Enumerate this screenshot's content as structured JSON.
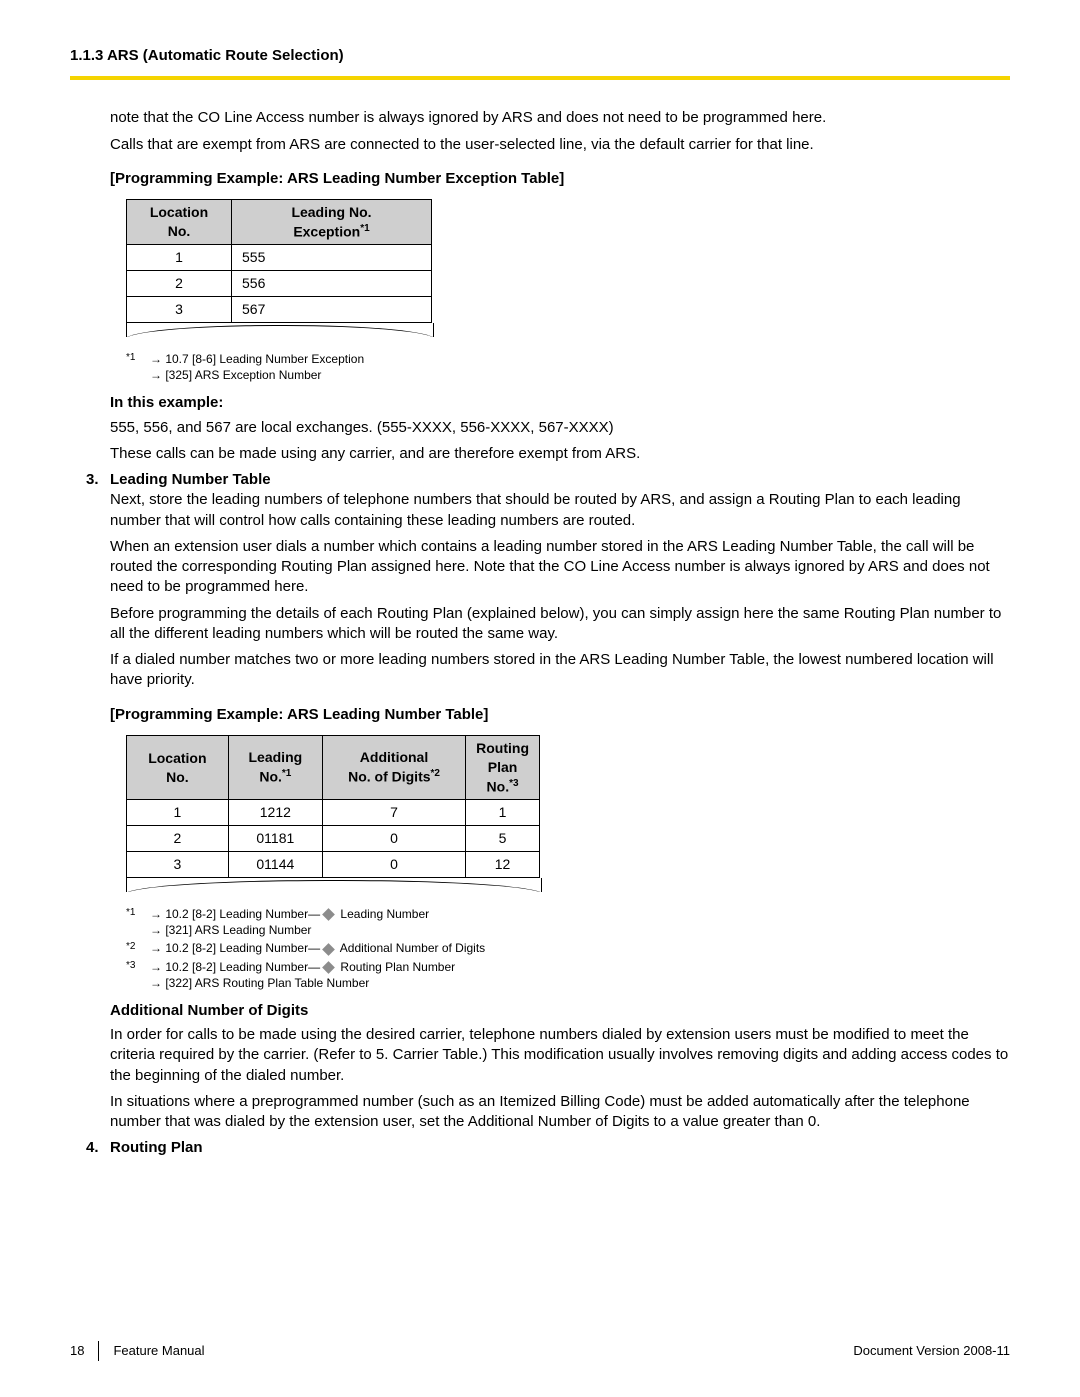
{
  "header": "1.1.3 ARS (Automatic Route Selection)",
  "intro_p1": "note that the CO Line Access number is always ignored by ARS and does not need to be programmed here.",
  "intro_p2": "Calls that are exempt from ARS are connected to the user-selected line, via the default carrier for that line.",
  "sec1_title": "[Programming Example: ARS Leading Number Exception Table]",
  "t1": {
    "h1a": "Location",
    "h1b": "No.",
    "h2a": "Leading No.",
    "h2b": "Exception",
    "h2sup": "*1",
    "rows": [
      {
        "loc": "1",
        "val": "555"
      },
      {
        "loc": "2",
        "val": "556"
      },
      {
        "loc": "3",
        "val": "567"
      }
    ]
  },
  "fn1": {
    "sup": "*1",
    "l1": "→ 10.7  [8-6] Leading Number Exception",
    "l2": "→ [325] ARS Exception Number"
  },
  "example_h": "In this example:",
  "example_p1": "555, 556, and 567 are local exchanges. (555-XXXX, 556-XXXX, 567-XXXX)",
  "example_p2": "These calls can be made using any carrier, and are therefore exempt from ARS.",
  "item3_num": "3.",
  "item3_title": "Leading Number Table",
  "item3_p1": "Next, store the leading numbers of telephone numbers that should be routed by ARS, and assign a Routing Plan to each leading number that will control how calls containing these leading numbers are routed.",
  "item3_p2": "When an extension user dials a number which contains a leading number stored in the ARS Leading Number Table, the call will be routed the corresponding Routing Plan assigned here. Note that the CO Line Access number is always ignored by ARS and does not need to be programmed here.",
  "item3_p3": "Before programming the details of each Routing Plan (explained below), you can simply assign here the same Routing Plan number to all the different leading numbers which will be routed the same way.",
  "item3_p4": "If a dialed number matches two or more leading numbers stored in the ARS Leading Number Table, the lowest numbered location will have priority.",
  "sec2_title": "[Programming Example: ARS Leading Number Table]",
  "t2": {
    "h1a": "Location",
    "h1b": "No.",
    "h2a": "Leading",
    "h2b": "No.",
    "h2sup": "*1",
    "h3a": "Additional",
    "h3b": "No. of Digits",
    "h3sup": "*2",
    "h4a": "Routing Plan",
    "h4b": "No.",
    "h4sup": "*3",
    "rows": [
      {
        "c1": "1",
        "c2": "1212",
        "c3": "7",
        "c4": "1"
      },
      {
        "c1": "2",
        "c2": "01181",
        "c3": "0",
        "c4": "5"
      },
      {
        "c1": "3",
        "c2": "01144",
        "c3": "0",
        "c4": "12"
      }
    ]
  },
  "fn2": {
    "a_sup": "*1",
    "a1_pre": "→ 10.2  [8-2] Leading Number—",
    "a1_post": " Leading Number",
    "a2": "→ [321] ARS Leading Number",
    "b_sup": "*2",
    "b1_pre": "→ 10.2  [8-2] Leading Number—",
    "b1_post": " Additional Number of Digits",
    "c_sup": "*3",
    "c1_pre": "→ 10.2  [8-2] Leading Number—",
    "c1_post": " Routing Plan Number",
    "c2": "→ [322] ARS Routing Plan Table Number"
  },
  "add_h": "Additional Number of Digits",
  "add_p1": "In order for calls to be made using the desired carrier, telephone numbers dialed by extension users must be modified to meet the criteria required by the carrier. (Refer to 5. Carrier Table.) This modification usually involves removing digits and adding access codes to the beginning of the dialed number.",
  "add_p2": "In situations where a preprogrammed number (such as an Itemized Billing Code) must be added automatically after the telephone number that was dialed by the extension user, set the Additional Number of Digits to a value greater than 0.",
  "item4_num": "4.",
  "item4_title": "Routing Plan",
  "footer": {
    "page": "18",
    "left": "Feature Manual",
    "right": "Document Version  2008-11"
  }
}
